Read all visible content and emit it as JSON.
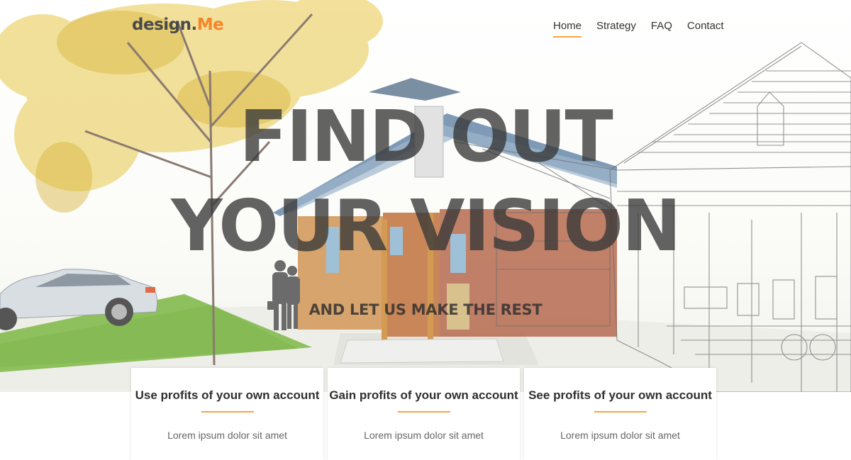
{
  "brand": {
    "name": "design.",
    "accent": "Me",
    "accent_color": "#f58529"
  },
  "nav": {
    "items": [
      "Home",
      "Strategy",
      "FAQ",
      "Contact"
    ],
    "active": "Home"
  },
  "hero": {
    "headline_line1": "FIND OUT",
    "headline_line2": "YOUR VISION",
    "subheadline": "AND LET US MAKE THE REST",
    "background": "house-architecture-render"
  },
  "cards": [
    {
      "title": "Use profits of your own account",
      "text": "Lorem ipsum dolor sit amet"
    },
    {
      "title": "Gain profits of your own account",
      "text": "Lorem ipsum dolor sit amet"
    },
    {
      "title": "See profits of your own account",
      "text": "Lorem ipsum dolor sit amet"
    }
  ],
  "colors": {
    "accent_underline": "#f5a442",
    "text_dark": "#333333"
  }
}
